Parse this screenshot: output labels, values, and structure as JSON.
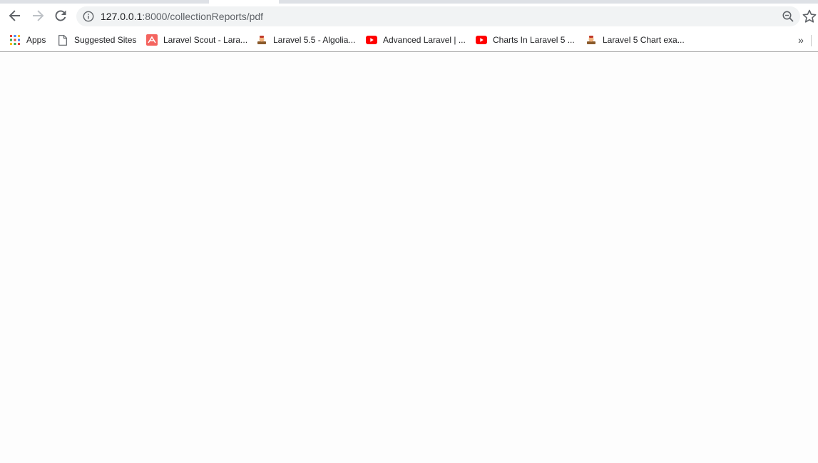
{
  "browser": {
    "url_host": "127.0.0.1",
    "url_path": ":8000/collectionReports/pdf"
  },
  "bookmarks": {
    "apps_label": "Apps",
    "items": [
      {
        "label": "Suggested Sites",
        "icon": "page-icon"
      },
      {
        "label": "Laravel Scout - Lara...",
        "icon": "laravel-icon"
      },
      {
        "label": "Laravel 5.5 - Algolia...",
        "icon": "itsolutionstuff-icon"
      },
      {
        "label": "Advanced Laravel | ...",
        "icon": "youtube-icon"
      },
      {
        "label": "Charts In Laravel 5 ...",
        "icon": "youtube-icon"
      },
      {
        "label": "Laravel 5 Chart exa...",
        "icon": "itsolutionstuff-icon"
      }
    ],
    "overflow_label": "»"
  },
  "colors": {
    "youtube_red": "#ff0000",
    "laravel_red": "#f4645f",
    "omnibox_bg": "#f1f3f4"
  }
}
